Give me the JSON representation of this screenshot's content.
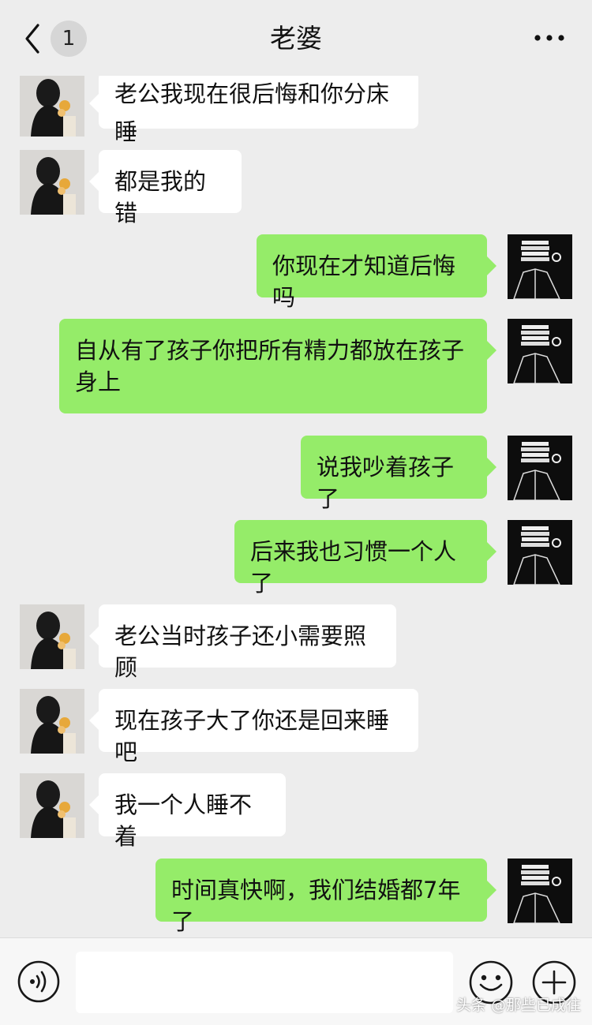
{
  "header": {
    "title": "老婆",
    "unread_count": "1"
  },
  "messages": [
    {
      "side": "left",
      "text": "老公我现在很后悔和你分床睡"
    },
    {
      "side": "left",
      "text": "都是我的错"
    },
    {
      "side": "right",
      "text": "你现在才知道后悔吗"
    },
    {
      "side": "right",
      "text": "自从有了孩子你把所有精力都放在孩子身上"
    },
    {
      "side": "right",
      "text": "说我吵着孩子了"
    },
    {
      "side": "right",
      "text": "后来我也习惯一个人了"
    },
    {
      "side": "left",
      "text": "老公当时孩子还小需要照顾"
    },
    {
      "side": "left",
      "text": "现在孩子大了你还是回来睡吧"
    },
    {
      "side": "left",
      "text": "我一个人睡不着"
    },
    {
      "side": "right",
      "text": "时间真快啊，我们结婚都7年了"
    }
  ],
  "footer": {
    "watermark": "头条 @那些已成往"
  },
  "colors": {
    "background": "#ededed",
    "outgoing_bubble": "#95ec69",
    "incoming_bubble": "#ffffff"
  },
  "icons": {
    "back": "chevron-left-icon",
    "more": "more-dots-icon",
    "voice": "voice-icon",
    "emoji": "emoji-icon",
    "plus": "plus-icon"
  }
}
